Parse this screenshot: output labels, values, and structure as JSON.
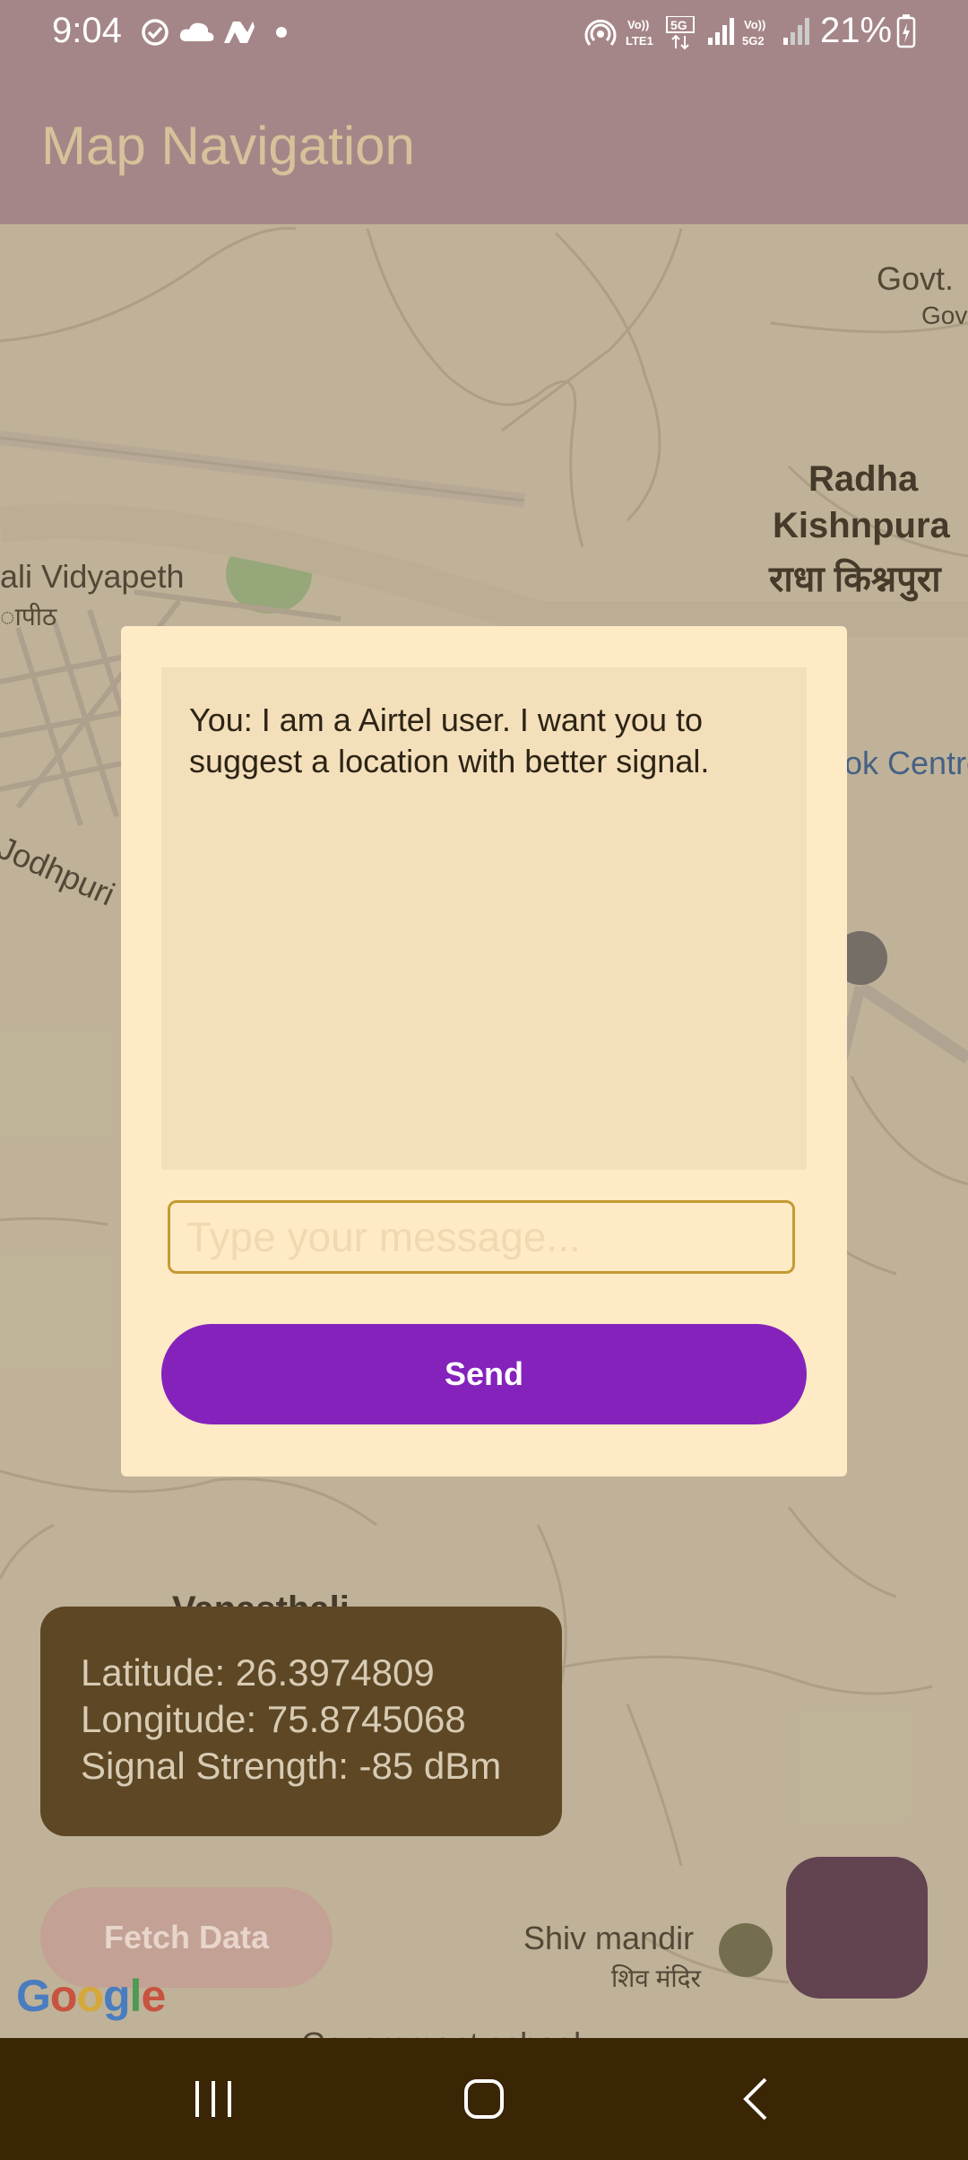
{
  "status_bar": {
    "time": "9:04",
    "battery": "21%",
    "icons": [
      "check-circle-icon",
      "cloud-icon",
      "app-icon",
      "dot-icon",
      "hotspot-icon",
      "volte-lte1-icon",
      "5g-icon",
      "signal-icon",
      "volte-5g2-icon",
      "signal-weak-icon",
      "battery-charging-icon"
    ]
  },
  "app_bar": {
    "title": "Map Navigation"
  },
  "map": {
    "labels": {
      "govt": "Govt.",
      "govt2": "Gov",
      "radha": "Radha",
      "kishnpura": "Kishnpura",
      "radha_hindi": "राधा किश्नपुरा",
      "vidyapeth": "ali Vidyapeth",
      "vidyapeth_hindi": "ापीठ",
      "jodhpuri": "Jodhpuri",
      "book_centre": "ok Centre",
      "vanasthali": "Vanasthali",
      "shiv_mandir": "Shiv mandir",
      "shiv_mandir_hindi": "शिव मंदिर",
      "government_school": "Government school"
    },
    "google_logo": "Google"
  },
  "dialog": {
    "chat_message": "You: I am a Airtel user. I want you to suggest a location with better signal.",
    "input_placeholder": "Type your message...",
    "input_value": "",
    "send_label": "Send"
  },
  "info_card": {
    "latitude": "Latitude: 26.3974809",
    "longitude": "Longitude: 75.8745068",
    "signal": "Signal Strength: -85 dBm"
  },
  "fetch_button_label": "Fetch Data",
  "colors": {
    "app_bar": "#a58688",
    "send_button": "#8522bb",
    "fetch_button": "#c3a194",
    "fab": "#624350",
    "info_card": "#5d4724",
    "nav_bar": "#3a2504"
  }
}
